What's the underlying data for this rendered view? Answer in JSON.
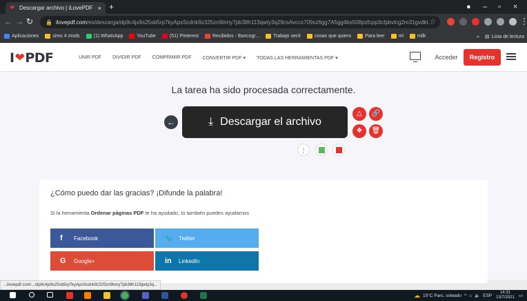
{
  "browser": {
    "tab_title": "Descargar archivo | iLovePDF",
    "tab_close": "×",
    "new_tab": "+",
    "window_controls": [
      "–",
      "▫",
      "×"
    ],
    "url_host": "ilovepdf.com",
    "url_path": "/es/descarga/dp9c4jx9s25sb5rp7kyApsScdnk9z325zn9tnny7pb38h113qwty3q29csAvccs709sz6gg7A5gg4bs508pzfcpp3cfpbvlcg2m31gvdkt...",
    "bookmarks": [
      {
        "label": "Aplicaciones",
        "color": "#4285f4"
      },
      {
        "label": "sims 4 mods",
        "color": "#f6c026"
      },
      {
        "label": "(1) WhatsApp",
        "color": "#25d366"
      },
      {
        "label": "YouTube",
        "color": "#ff0000"
      },
      {
        "label": "(51) Pinterest",
        "color": "#e60023"
      },
      {
        "label": "Recibidos - tburcogr...",
        "color": "#ea4335"
      },
      {
        "label": "Trabajo secit",
        "color": "#f6c026"
      },
      {
        "label": "cosas que quiero",
        "color": "#f6c026"
      },
      {
        "label": "Para leer",
        "color": "#f6c026"
      },
      {
        "label": "ml",
        "color": "#f6c026"
      },
      {
        "label": "milk",
        "color": "#f6c026"
      }
    ],
    "bookmarks_more": "»",
    "reading_list": "Lista de lectura"
  },
  "header": {
    "logo_left": "I",
    "logo_right": "PDF",
    "nav": [
      "UNIR PDF",
      "DIVIDIR PDF",
      "COMPRIMIR PDF",
      "CONVERTIR PDF ▾",
      "TODAS LAS HERRAMIENTAS PDF ▾"
    ],
    "login": "Acceder",
    "register": "Registro"
  },
  "main": {
    "heading": "La tarea ha sido procesada correctamente.",
    "download_label": "Descargar el archivo",
    "icons": {
      "back": "←",
      "download": "⤓",
      "drive": "△",
      "link": "🔗",
      "dropbox": "❖",
      "delete": "🗑",
      "more": "⋮"
    }
  },
  "share": {
    "title": "¿Cómo puedo dar las gracias? ¡Difunde la palabra!",
    "text_before": "Si la herramienta ",
    "tool_name": "Ordenar páginas PDF",
    "text_after": " te ha ayudado, tú también puedes ayudarnos",
    "buttons": [
      {
        "label": "Facebook",
        "icon": "f",
        "color": "#3b5998"
      },
      {
        "label": "Twitter",
        "icon": "🐦",
        "color": "#55acee"
      },
      {
        "label": "Google+",
        "icon": "G",
        "color": "#dd4b39"
      },
      {
        "label": "LinkedIn",
        "icon": "in",
        "color": "#0e76a8"
      }
    ]
  },
  "status_url": "...ilovepdf.com/.../dp9c4jx9s25sb5rp7kyApsScdnk9z325zn9tnny7pb38h113qwty3q...",
  "taskbar": {
    "weather": "15°C  Parc. soleado",
    "lang": "ESP",
    "time": "14:31",
    "date": "13/7/2021"
  }
}
